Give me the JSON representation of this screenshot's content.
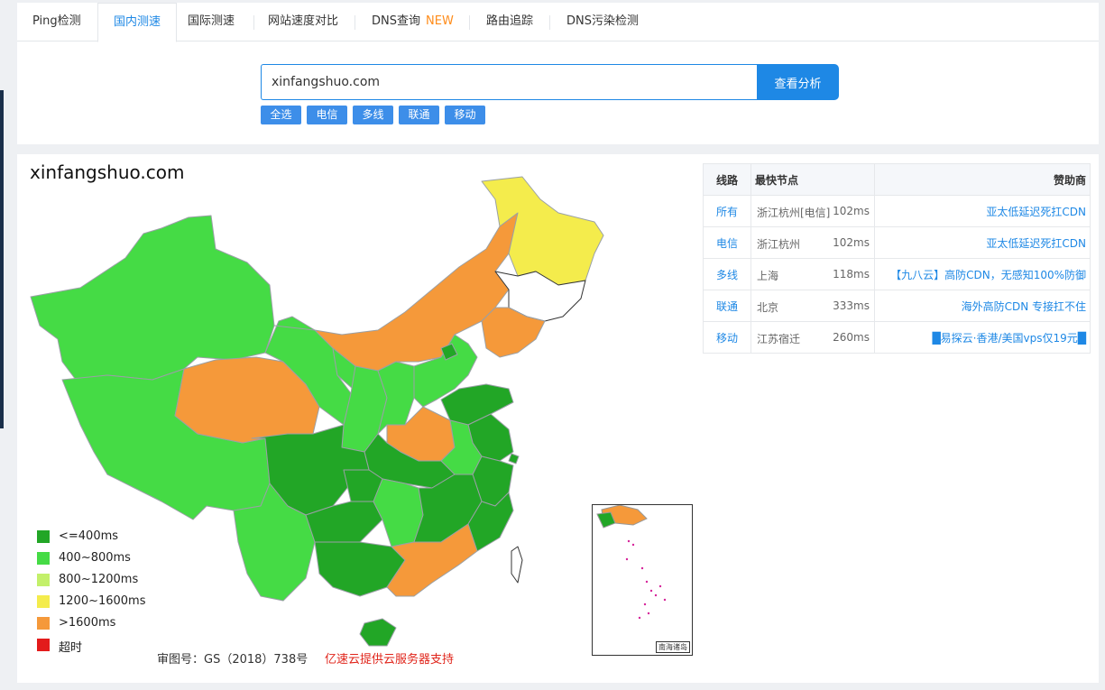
{
  "tabs": [
    {
      "label": "Ping检测"
    },
    {
      "label": "国内测速"
    },
    {
      "label": "国际测速"
    },
    {
      "label": "网站速度对比"
    },
    {
      "label": "DNS查询",
      "badge": "NEW"
    },
    {
      "label": "路由追踪"
    },
    {
      "label": "DNS污染检测"
    }
  ],
  "active_tab": "国内测速",
  "search": {
    "value": "xinfangshuo.com",
    "button": "查看分析"
  },
  "chips": [
    "全选",
    "电信",
    "多线",
    "联通",
    "移动"
  ],
  "map": {
    "title": "xinfangshuo.com",
    "legend": [
      {
        "label": "<=400ms",
        "color": "#22a626"
      },
      {
        "label": "400~800ms",
        "color": "#45db45"
      },
      {
        "label": "800~1200ms",
        "color": "#c3f06a"
      },
      {
        "label": "1200~1600ms",
        "color": "#f4ec4c"
      },
      {
        "label": ">1600ms",
        "color": "#f5993a"
      },
      {
        "label": "超时",
        "color": "#e31b1b"
      }
    ],
    "approval": "审图号：GS（2018）738号",
    "support": "亿速云提供云服务器支持",
    "inset_caption": "南海诸岛"
  },
  "table": {
    "headers": [
      "线路",
      "最快节点",
      "赞助商"
    ],
    "rows": [
      {
        "line": "所有",
        "node": "浙江杭州[电信]",
        "ms": "102ms",
        "sponsor": "亚太低延迟死扛CDN"
      },
      {
        "line": "电信",
        "node": "浙江杭州",
        "ms": "102ms",
        "sponsor": "亚太低延迟死扛CDN"
      },
      {
        "line": "多线",
        "node": "上海",
        "ms": "118ms",
        "sponsor": "【九八云】高防CDN，无感知100%防御"
      },
      {
        "line": "联通",
        "node": "北京",
        "ms": "333ms",
        "sponsor": "海外高防CDN 专接扛不住"
      },
      {
        "line": "移动",
        "node": "江苏宿迁",
        "ms": "260ms",
        "sponsor": "█易探云·香港/美国vps仅19元█"
      }
    ]
  }
}
